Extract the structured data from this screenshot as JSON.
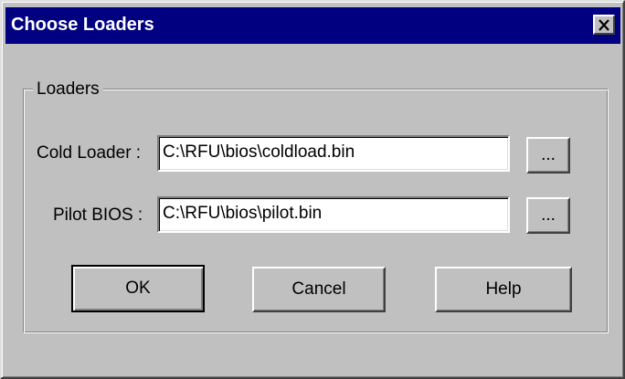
{
  "window": {
    "title": "Choose Loaders",
    "close_glyph": "✕"
  },
  "group": {
    "label": "Loaders"
  },
  "fields": {
    "cold_loader": {
      "label": "Cold Loader :",
      "value": "C:\\RFU\\bios\\coldload.bin",
      "browse_label": "..."
    },
    "pilot_bios": {
      "label": "Pilot BIOS :",
      "value": "C:\\RFU\\bios\\pilot.bin",
      "browse_label": "..."
    }
  },
  "buttons": {
    "ok": "OK",
    "cancel": "Cancel",
    "help": "Help"
  },
  "icons": {
    "close": "close-icon"
  },
  "colors": {
    "titlebar": "#000080",
    "face": "#c0c0c0",
    "title_text": "#ffffff"
  }
}
